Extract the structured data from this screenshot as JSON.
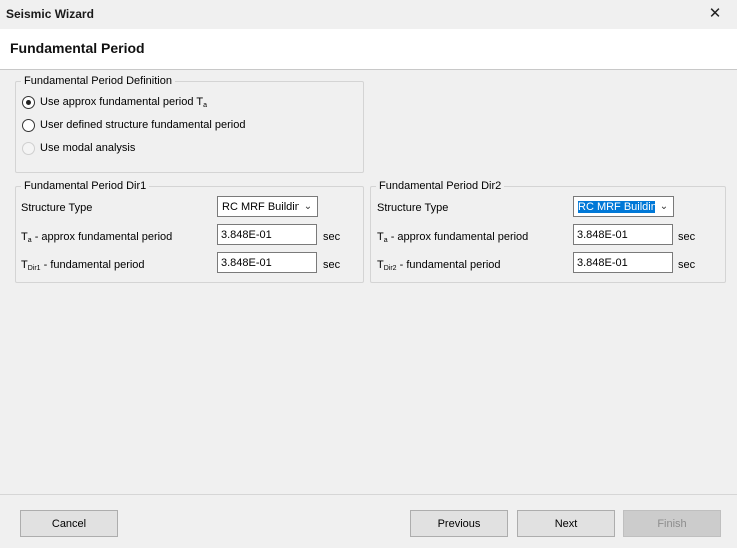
{
  "window": {
    "title": "Seismic Wizard",
    "close_glyph": "✕"
  },
  "header": {
    "title": "Fundamental Period"
  },
  "definition": {
    "legend": "Fundamental Period Definition",
    "options": [
      {
        "label": "Use approx fundamental period T",
        "sub": "a",
        "checked": true,
        "enabled": true
      },
      {
        "label": "User defined structure fundamental period",
        "sub": "",
        "checked": false,
        "enabled": true
      },
      {
        "label": "Use modal analysis",
        "sub": "",
        "checked": false,
        "enabled": false
      }
    ]
  },
  "dir1": {
    "legend": "Fundamental Period Dir1",
    "structure_type_label": "Structure Type",
    "structure_type_value": "RC MRF Building",
    "approx_label_main": "T",
    "approx_label_sub": "a",
    "approx_label_rest": " - approx fundamental period",
    "approx_value": "3.848E-01",
    "fund_label_main": "T",
    "fund_label_sub": "Dir1",
    "fund_label_rest": " - fundamental period",
    "fund_value": "3.848E-01",
    "unit": "sec"
  },
  "dir2": {
    "legend": "Fundamental Period Dir2",
    "structure_type_label": "Structure Type",
    "structure_type_value": "RC MRF Building",
    "approx_label_main": "T",
    "approx_label_sub": "a",
    "approx_label_rest": " - approx fundamental period",
    "approx_value": "3.848E-01",
    "fund_label_main": "T",
    "fund_label_sub": "Dir2",
    "fund_label_rest": " - fundamental period",
    "fund_value": "3.848E-01",
    "unit": "sec"
  },
  "footer": {
    "cancel_label": "Cancel",
    "previous_label": "Previous",
    "next_label": "Next",
    "finish_label": "Finish"
  },
  "colors": {
    "focus_highlight": "#0078d7",
    "disabled_button": "#cccccc"
  }
}
